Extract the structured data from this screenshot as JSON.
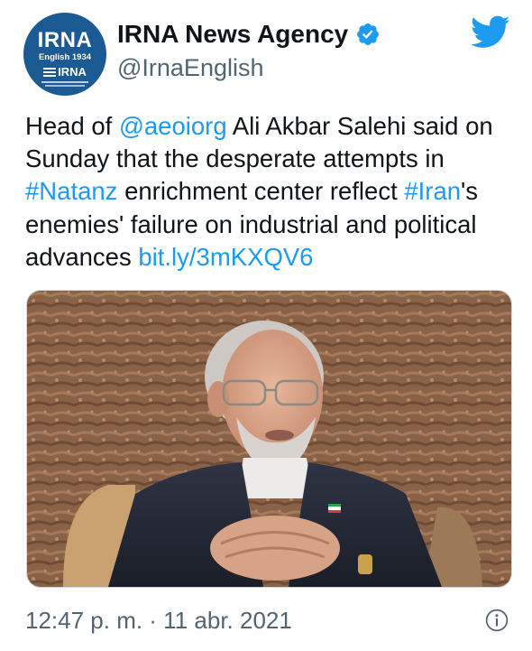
{
  "account": {
    "avatar_logo_text": "IRNA",
    "avatar_logo_subtext": "English 1934",
    "avatar_logo_small": "IRNA",
    "display_name": "IRNA News Agency",
    "handle": "@IrnaEnglish",
    "verified_icon": "verified-badge-icon"
  },
  "brand_icon": "twitter-bird-icon",
  "tweet": {
    "segments": [
      {
        "text": "Head of ",
        "type": "text"
      },
      {
        "text": "@aeoiorg",
        "type": "link"
      },
      {
        "text": " Ali Akbar Salehi said on Sunday that the desperate attempts in ",
        "type": "text"
      },
      {
        "text": "#Natanz",
        "type": "link"
      },
      {
        "text": " enrichment center reflect ",
        "type": "text"
      },
      {
        "text": "#Iran",
        "type": "link"
      },
      {
        "text": "'s enemies' failure on industrial and political advances ",
        "type": "text"
      },
      {
        "text": "bit.ly/3mKXQV6",
        "type": "link"
      }
    ],
    "timestamp": "12:47 p. m. · 11 abr. 2021",
    "info_icon": "info-icon"
  },
  "colors": {
    "link": "#1d9bf0",
    "verified": "#1d9bf0",
    "twitter_blue": "#1d9bf0",
    "avatar_bg": "#1c5a93",
    "secondary_text": "#536471"
  }
}
